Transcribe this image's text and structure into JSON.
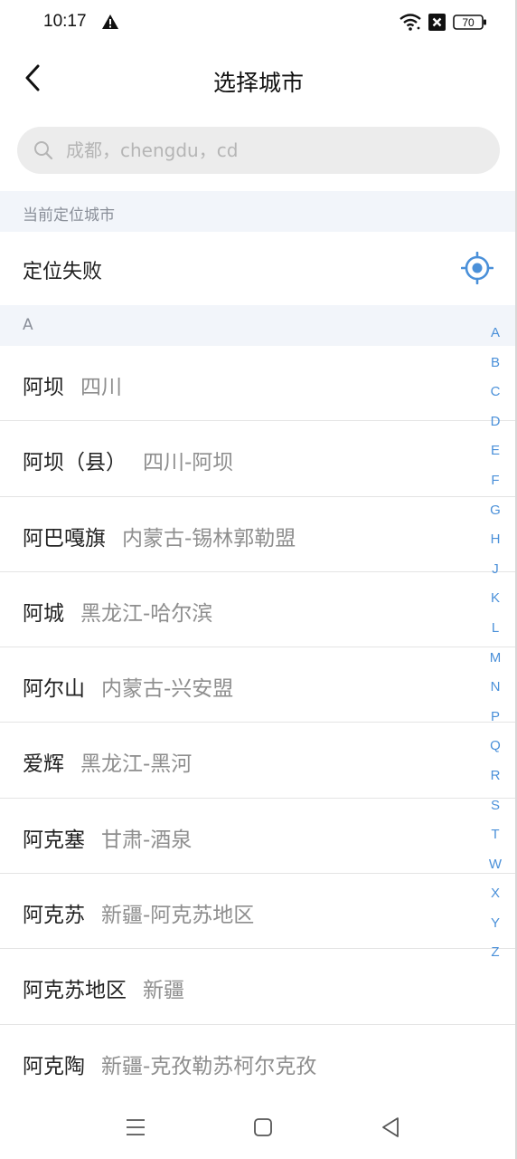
{
  "status_bar": {
    "time": "10:17",
    "battery": "70"
  },
  "nav": {
    "title": "选择城市"
  },
  "search": {
    "placeholder": "成都，chengdu，cd"
  },
  "current_location": {
    "section_label": "当前定位城市",
    "status_text": "定位失败"
  },
  "city_section": {
    "letter": "A",
    "cities": [
      {
        "name": "阿坝",
        "region": "四川"
      },
      {
        "name": "阿坝（县）",
        "region": "四川-阿坝"
      },
      {
        "name": "阿巴嘎旗",
        "region": "内蒙古-锡林郭勒盟"
      },
      {
        "name": "阿城",
        "region": "黑龙江-哈尔滨"
      },
      {
        "name": "阿尔山",
        "region": "内蒙古-兴安盟"
      },
      {
        "name": "爱辉",
        "region": "黑龙江-黑河"
      },
      {
        "name": "阿克塞",
        "region": "甘肃-酒泉"
      },
      {
        "name": "阿克苏",
        "region": "新疆-阿克苏地区"
      },
      {
        "name": "阿克苏地区",
        "region": "新疆"
      },
      {
        "name": "阿克陶",
        "region": "新疆-克孜勒苏柯尔克孜"
      }
    ]
  },
  "alpha_index": [
    "A",
    "B",
    "C",
    "D",
    "E",
    "F",
    "G",
    "H",
    "J",
    "K",
    "L",
    "M",
    "N",
    "P",
    "Q",
    "R",
    "S",
    "T",
    "W",
    "X",
    "Y",
    "Z"
  ],
  "colors": {
    "accent": "#4a90d9",
    "section_bg": "#f2f5fa",
    "secondary_text": "#8e8e8e"
  },
  "icons": {
    "back": "chevron-left-icon",
    "search": "search-icon",
    "locate": "locate-target-icon",
    "nav_menu": "menu-icon",
    "nav_home": "home-square-icon",
    "nav_back": "triangle-back-icon"
  }
}
